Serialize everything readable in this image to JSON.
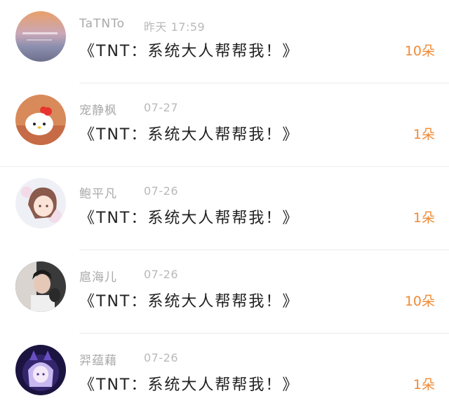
{
  "colors": {
    "username": "#a9a9a9",
    "date": "#b9b9b9",
    "message": "#222222",
    "gift": "#ef8a36",
    "divider": "#ececec"
  },
  "items": [
    {
      "username": "TaTNTo",
      "date": "昨天 17:59",
      "message": "《TNT：系统大人帮帮我！》",
      "gift": "10朵",
      "avatar": "sunset-sea-avatar"
    },
    {
      "username": "宠静枫",
      "date": "07-27",
      "message": "《TNT：系统大人帮帮我！》",
      "gift": "1朵",
      "avatar": "hello-kitty-avatar"
    },
    {
      "username": "鲍平凡",
      "date": "07-26",
      "message": "《TNT：系统大人帮帮我！》",
      "gift": "1朵",
      "avatar": "anime-girl-avatar"
    },
    {
      "username": "扈海儿",
      "date": "07-26",
      "message": "《TNT：系统大人帮帮我！》",
      "gift": "10朵",
      "avatar": "photo-couple-avatar"
    },
    {
      "username": "羿蕴藉",
      "date": "07-26",
      "message": "《TNT：系统大人帮帮我！》",
      "gift": "1朵",
      "avatar": "anime-cat-ears-avatar"
    }
  ]
}
